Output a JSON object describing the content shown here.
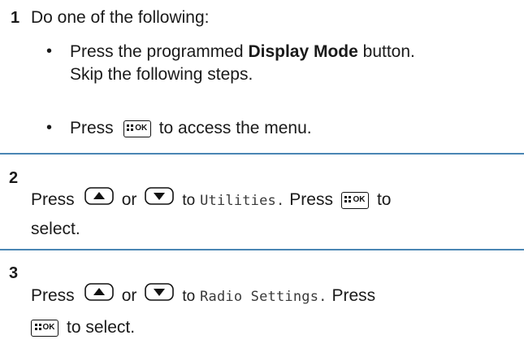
{
  "steps": [
    {
      "number": "1",
      "intro": "Do one of the following:",
      "options": [
        {
          "bullet": "•",
          "pre": "Press the programmed ",
          "bold": "Display Mode",
          "post": " button.",
          "line2": "Skip the following steps."
        },
        {
          "bullet": "•",
          "pre": "Press",
          "key": "OK",
          "post": "to access the menu."
        }
      ]
    },
    {
      "number": "2",
      "press": "Press",
      "or": "or",
      "to": "to",
      "menu_item": "Utilities.",
      "press2": "Press",
      "to2": "to",
      "line2": "select."
    },
    {
      "number": "3",
      "press": "Press",
      "or": "or",
      "to": "to",
      "menu_item": "Radio Settings.",
      "press2": "Press",
      "line2_post": "to select."
    }
  ],
  "keys": {
    "ok_label": "OK",
    "up_icon": "up-arrow-key-icon",
    "down_icon": "down-arrow-key-icon",
    "menu_icon": "menu-ok-key-icon"
  },
  "colors": {
    "divider": "#4a86b4",
    "text": "#1a1a1a"
  }
}
